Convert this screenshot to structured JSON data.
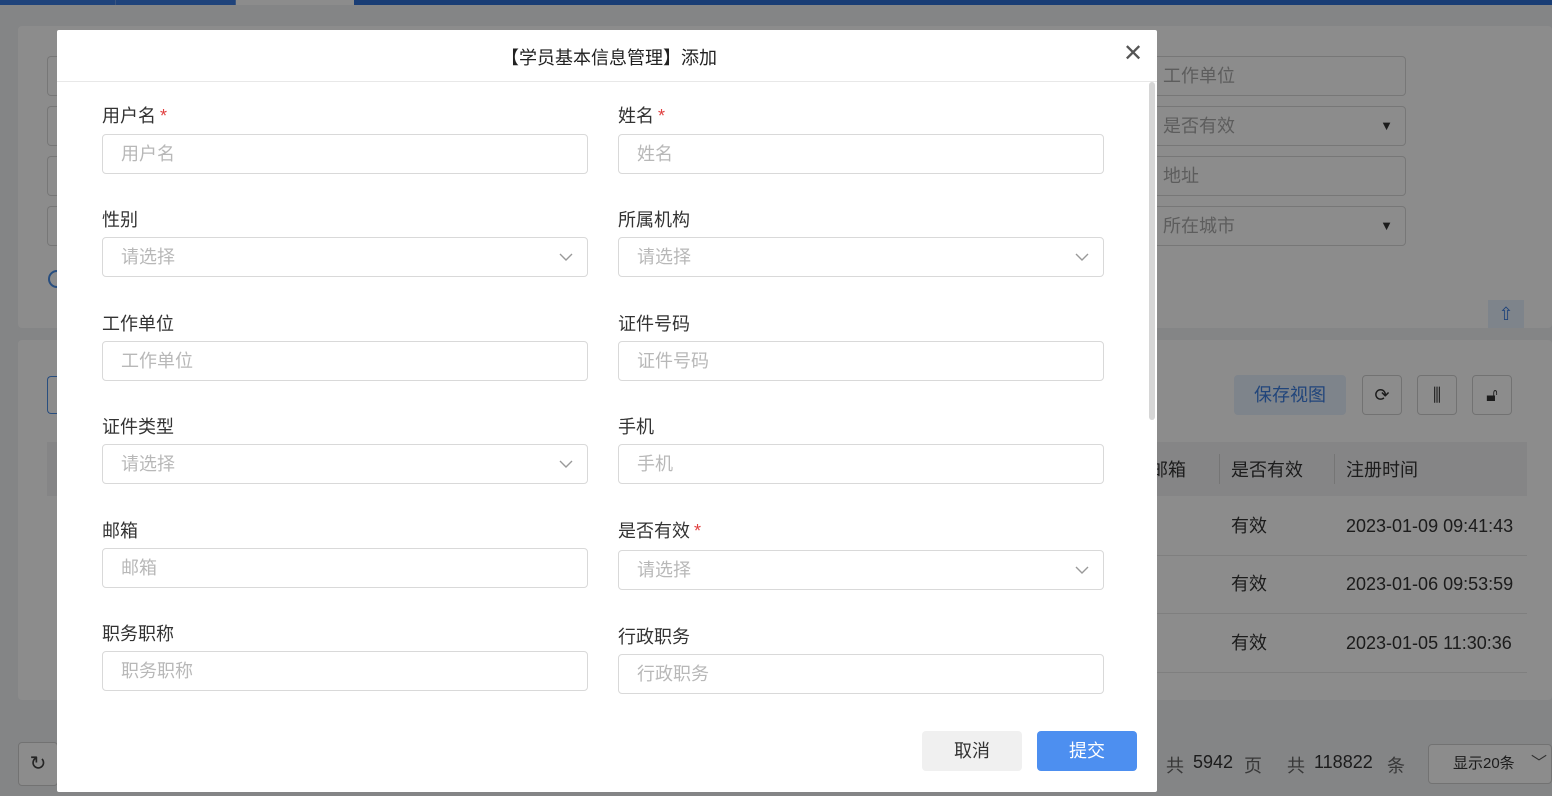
{
  "background": {
    "search_fields": [
      {
        "placeholder": "工作单位",
        "type": "input"
      },
      {
        "placeholder": "是否有效",
        "type": "select"
      },
      {
        "placeholder": "地址",
        "type": "input"
      },
      {
        "placeholder": "所在城市",
        "type": "select"
      }
    ],
    "toolbar": {
      "save_view_label": "保存视图"
    },
    "table": {
      "columns": [
        "邮箱",
        "是否有效",
        "注册时间"
      ],
      "rows": [
        {
          "valid": "有效",
          "registered": "2023-01-09 09:41:43"
        },
        {
          "valid": "有效",
          "registered": "2023-01-06 09:53:59"
        },
        {
          "valid": "有效",
          "registered": "2023-01-05 11:30:36"
        }
      ]
    },
    "pager": {
      "total_prefix": "共",
      "total_pages": "5942",
      "pages_suffix": "页",
      "total_items": "118822",
      "items_suffix": "条",
      "page_size_label": "显示20条"
    }
  },
  "dialog": {
    "title": "【学员基本信息管理】添加",
    "required_mark": "*",
    "fields": {
      "username": {
        "label": "用户名",
        "placeholder": "用户名",
        "value": ""
      },
      "name": {
        "label": "姓名",
        "placeholder": "姓名",
        "value": ""
      },
      "gender": {
        "label": "性别",
        "placeholder": "请选择"
      },
      "organization": {
        "label": "所属机构",
        "placeholder": "请选择"
      },
      "work_unit": {
        "label": "工作单位",
        "placeholder": "工作单位",
        "value": ""
      },
      "id_number": {
        "label": "证件号码",
        "placeholder": "证件号码",
        "value": ""
      },
      "id_type": {
        "label": "证件类型",
        "placeholder": "请选择"
      },
      "mobile": {
        "label": "手机",
        "placeholder": "手机",
        "value": ""
      },
      "email": {
        "label": "邮箱",
        "placeholder": "邮箱",
        "value": ""
      },
      "is_valid": {
        "label": "是否有效",
        "placeholder": "请选择"
      },
      "job_title": {
        "label": "职务职称",
        "placeholder": "职务职称",
        "value": ""
      },
      "admin_position": {
        "label": "行政职务",
        "placeholder": "行政职务",
        "value": ""
      }
    },
    "buttons": {
      "cancel": "取消",
      "submit": "提交"
    }
  },
  "colors": {
    "primary": "#4d8ff0",
    "required": "#e04040",
    "mask": "rgba(0,0,0,0.45)"
  }
}
